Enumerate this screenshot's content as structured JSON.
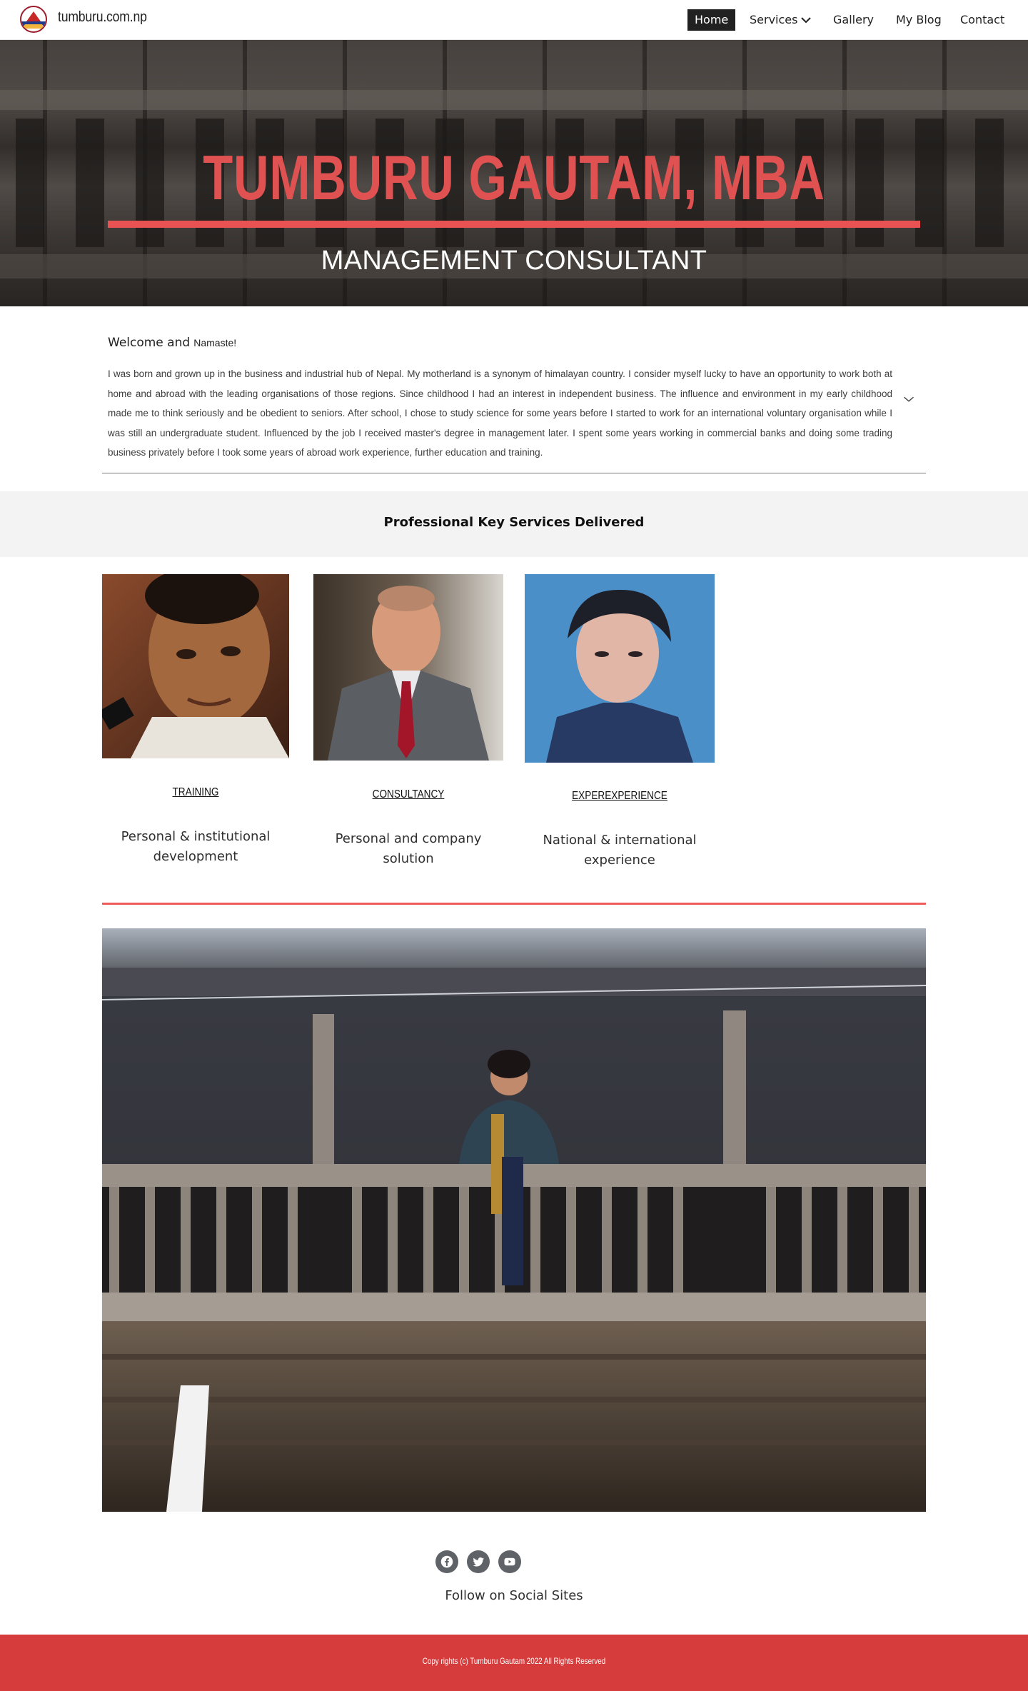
{
  "header": {
    "site_title": "tumburu.com.np",
    "nav": [
      "Home",
      "Services",
      "Gallery",
      "My Blog",
      "Contact"
    ],
    "active": "Home"
  },
  "hero": {
    "title": "TUMBURU GAUTAM, MBA",
    "subtitle": "MANAGEMENT CONSULTANT",
    "accent_color": "#e95252"
  },
  "welcome": {
    "greeting": "Welcome and",
    "greeting_small": "Namaste!",
    "body": "I was born and grown up in the business and industrial hub of Nepal. My motherland is a synonym of himalayan country. I consider myself lucky to have an opportunity to work both at home and abroad with the leading organisations of those regions. Since childhood I had an interest in independent business. The influence and environment in my early childhood made me to think seriously and be obedient to seniors. After school, I chose to study science for some years before I started to work for an international voluntary organisation while I was still an undergraduate student. Influenced by the job I received master's degree in management later. I spent some years working in commercial banks and doing some trading business privately before I took some years of abroad work experience, further education and training."
  },
  "services": {
    "heading": "Professional Key Services Delivered",
    "cards": [
      {
        "title": "TRAINING ",
        "desc_line1": "Personal & institutional",
        "desc_line2": "development"
      },
      {
        "title": "CONSULTANCY",
        "desc_line1": "Personal and company",
        "desc_line2": "solution"
      },
      {
        "title": "EXPEREXPERIENCE",
        "desc_line1": "National & international",
        "desc_line2": "experience"
      }
    ]
  },
  "social": {
    "icons": [
      "facebook-icon",
      "twitter-icon",
      "youtube-icon"
    ],
    "label": "Follow on Social Sites"
  },
  "footer": {
    "text": "Copy rights (c) Tumburu Gautam 2022 All Rights Reserved",
    "color": "#d63c3c"
  }
}
